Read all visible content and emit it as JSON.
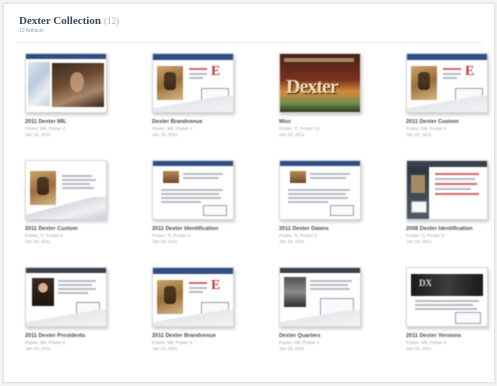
{
  "header": {
    "title": "Dexter Collection",
    "count": "(12)",
    "subtitle": "12 Artifacts"
  },
  "items": [
    {
      "name": "2011 Dexter MIL",
      "line1": "Poster, Mil, Poster 2",
      "line2": "Jan 18, 2011",
      "thumb": "map-photo"
    },
    {
      "name": "Dexter Brandvenue",
      "line1": "Poster, Mil, Poster 4",
      "line2": "Jan 18, 2011",
      "thumb": "poster-logo"
    },
    {
      "name": "Misc",
      "line1": "Poster, Ti, Poster 12",
      "line2": "Jan 18, 2011",
      "thumb": "dexter-title"
    },
    {
      "name": "2011 Dexter Custom",
      "line1": "Poster, Mil, Poster 6",
      "line2": "Jan 18, 2011",
      "thumb": "poster-logo"
    },
    {
      "name": "2011 Dexter Custom",
      "line1": "Poster, Ti, Poster 6",
      "line2": "Jan 18, 2011",
      "thumb": "poster-swoosh"
    },
    {
      "name": "2011 Dexter Identification",
      "line1": "Poster, Ti, Poster 6",
      "line2": "Jan 18, 2011",
      "thumb": "letter"
    },
    {
      "name": "2011 Dexter Dawns",
      "line1": "Poster, Ti, Poster 6",
      "line2": "Jan 18, 2011",
      "thumb": "letter"
    },
    {
      "name": "2008 Dexter Identification",
      "line1": "Poster, Ti, Poster 6",
      "line2": "Jan 18, 2011",
      "thumb": "dark-side"
    },
    {
      "name": "2011 Dexter Presidents",
      "line1": "Poster, Mil, Poster 6",
      "line2": "Jan 18, 2011",
      "thumb": "portrait"
    },
    {
      "name": "2011 Dexter Brandvenue",
      "line1": "Poster, Mil, Poster 6",
      "line2": "Jan 18, 2011",
      "thumb": "poster-logo"
    },
    {
      "name": "Dexter Quarters",
      "line1": "Poster, Mil, Poster 6",
      "line2": "Jan 18, 2011",
      "thumb": "bw-photo"
    },
    {
      "name": "2011 Dexter Versions",
      "line1": "Poster, Mil, Poster 6",
      "line2": "Jan 18, 2011",
      "thumb": "dark-banner"
    }
  ]
}
